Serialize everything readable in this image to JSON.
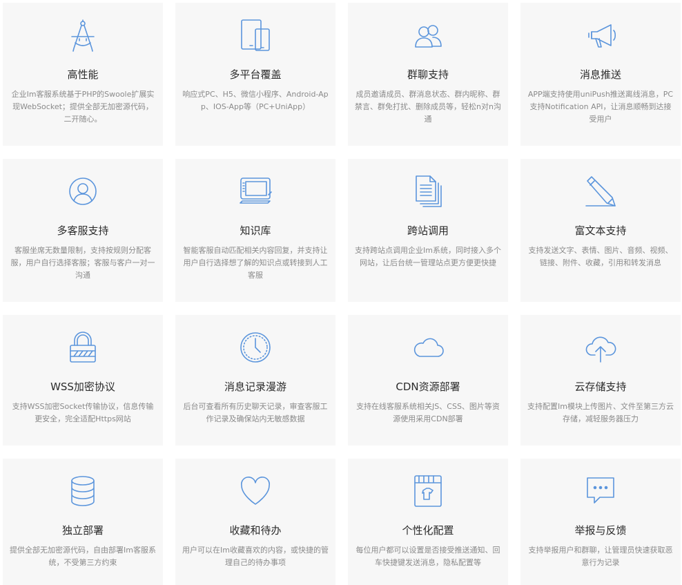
{
  "accent_color": "#5b95dc",
  "features": [
    {
      "icon": "compass-icon",
      "title": "高性能",
      "desc": "企业Im客服系统基于PHP的Swoole扩展实现WebSocket；提供全部无加密源代码，二开随心。"
    },
    {
      "icon": "devices-icon",
      "title": "多平台覆盖",
      "desc": "响应式PC、H5、微信小程序、Android-App、IOS-App等（PC+UniApp）"
    },
    {
      "icon": "users-icon",
      "title": "群聊支持",
      "desc": "成员邀请成员、群消息状态、群内昵称、群禁言、群免打扰、删除成员等，轻松n对n沟通"
    },
    {
      "icon": "megaphone-icon",
      "title": "消息推送",
      "desc": "APP端支持使用uniPush推送离线消息，PC支持Notification API，让消息顺畅到达接受用户"
    },
    {
      "icon": "user-circle-icon",
      "title": "多客服支持",
      "desc": "客服坐席无数量限制，支持按规则分配客服，用户自行选择客服；客服与客户一对一沟通"
    },
    {
      "icon": "tablet-icon",
      "title": "知识库",
      "desc": "智能客服自动匹配相关内容回复，并支持让用户自行选择想了解的知识点或转接到人工客服"
    },
    {
      "icon": "documents-icon",
      "title": "跨站调用",
      "desc": "支持跨站点调用企业Im系统，同时接入多个网站，让后台统一管理站点更方便更快捷"
    },
    {
      "icon": "pencil-icon",
      "title": "富文本支持",
      "desc": "支持发送文字、表情、图片、音频、视频、链接、附件、收藏，引用和转发消息"
    },
    {
      "icon": "padlock-icon",
      "title": "WSS加密协议",
      "desc": "支持WSS加密Socket传输协议，信息传输更安全，完全适配Https网站"
    },
    {
      "icon": "clock-icon",
      "title": "消息记录漫游",
      "desc": "后台可查看所有历史聊天记录，审查客服工作记录及确保站内无敏感数据"
    },
    {
      "icon": "cloud-icon",
      "title": "CDN资源部署",
      "desc": "支持在线客服系统相关JS、CSS、图片等资源使用采用CDN部署"
    },
    {
      "icon": "cloud-upload-icon",
      "title": "云存储支持",
      "desc": "支持配置Im模块上传图片、文件至第三方云存储，减轻服务器压力"
    },
    {
      "icon": "database-icon",
      "title": "独立部署",
      "desc": "提供全部无加密源代码，自由部署Im客服系统，不受第三方约束"
    },
    {
      "icon": "heart-icon",
      "title": "收藏和待办",
      "desc": "用户可以在Im收藏喜欢的内容，或快捷的管理自己的待办事项"
    },
    {
      "icon": "shop-icon",
      "title": "个性化配置",
      "desc": "每位用户都可以设置是否接受推送通知、回车快捷键发送消息，隐私配置等"
    },
    {
      "icon": "chat-bubble-icon",
      "title": "举报与反馈",
      "desc": "支持举报用户和群聊，让管理员快速获取恶意行为记录"
    }
  ]
}
